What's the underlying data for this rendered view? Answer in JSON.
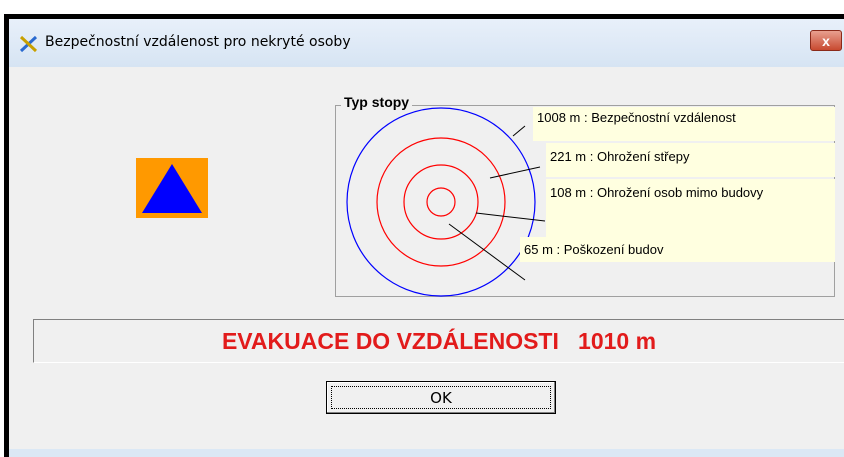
{
  "window": {
    "title": "Bezpečnostní vzdálenost pro nekryté osoby",
    "close_label": "x"
  },
  "group": {
    "legend": "Typ stopy"
  },
  "zones": [
    {
      "label": "1008 m : Bezpečnostní vzdálenost",
      "color": "#0000ff"
    },
    {
      "label": "221 m : Ohrožení střepy",
      "color": "#ff0000"
    },
    {
      "label": "108 m : Ohrožení osob mimo budovy",
      "color": "#ff0000"
    },
    {
      "label": "65 m : Poškození budov",
      "color": "#ff0000"
    }
  ],
  "logo": {
    "icon": "civil-protection-triangle-icon",
    "bg_color": "#ff9900",
    "triangle_color": "#0000ff"
  },
  "evacuation": {
    "text": "EVAKUACE DO VZDÁLENOSTI   1010 m",
    "color": "#e21b1b"
  },
  "ok_button": {
    "label": "OK"
  }
}
